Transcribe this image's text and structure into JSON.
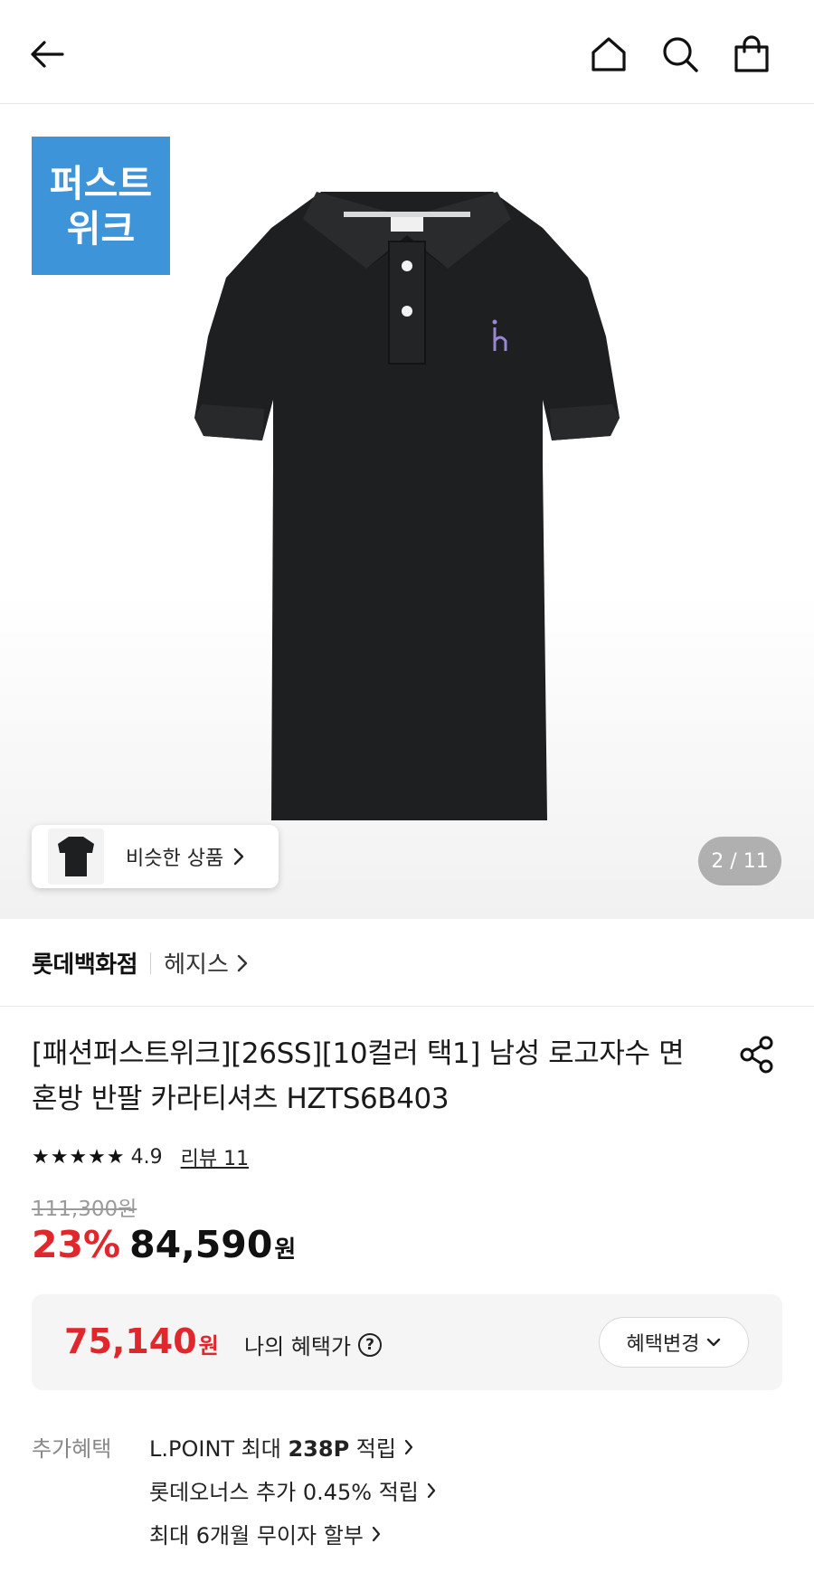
{
  "header": {
    "back_icon": "arrow-left-icon",
    "home_icon": "home-icon",
    "search_icon": "search-icon",
    "cart_icon": "shopping-bag-icon"
  },
  "gallery": {
    "badge_line1": "퍼스트",
    "badge_line2": "위크",
    "badge_color": "#3d94d9",
    "similar_label": "비슷한 상품",
    "pager": "2 / 11"
  },
  "brandrow": {
    "store": "롯데백화점",
    "brand": "헤지스"
  },
  "product": {
    "title": "[패션퍼스트위크][26SS][10컬러 택1] 남성 로고자수 면혼방 반팔 카라티셔츠 HZTS6B403",
    "rating": {
      "stars": "★★★★★",
      "score": "4.9",
      "reviews": "리뷰 11"
    },
    "original_price": "111,300원",
    "discount": "23%",
    "sale_price": "84,590",
    "sale_won": "원",
    "accent_color": "#e0272b"
  },
  "benefit": {
    "price": "75,140",
    "won": "원",
    "label": "나의 혜택가",
    "help": "?",
    "button": "혜택변경"
  },
  "extra": {
    "label": "추가혜택",
    "items": [
      {
        "prefix": "L.POINT 최대 ",
        "bold": "238P",
        "suffix": " 적립"
      },
      {
        "prefix": "롯데오너스 추가 0.45% 적립",
        "bold": "",
        "suffix": ""
      },
      {
        "prefix": "최대 6개월 무이자 할부",
        "bold": "",
        "suffix": ""
      }
    ]
  }
}
